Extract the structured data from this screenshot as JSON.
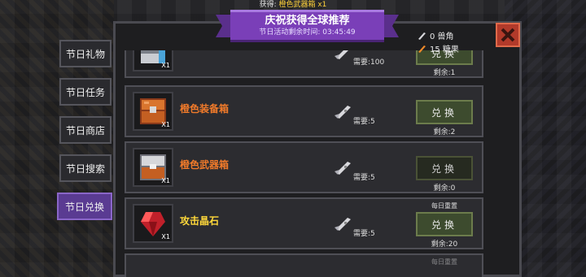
{
  "toast": {
    "prefix": "获得: ",
    "item": "橙色武器箱 x1"
  },
  "banner": {
    "title": "庆祝获得全球推荐",
    "timer": "节日活动剩余时间: 03:45:49"
  },
  "resources": [
    {
      "icon": "horn-icon",
      "text": "0 兽角"
    },
    {
      "icon": "candy-icon",
      "text": "15 糖果"
    }
  ],
  "tabs": [
    {
      "label": "节日礼物"
    },
    {
      "label": "节日任务"
    },
    {
      "label": "节日商店"
    },
    {
      "label": "节日搜索"
    },
    {
      "label": "节日兑换",
      "active": true
    }
  ],
  "items": [
    {
      "name": "",
      "icon": "supply-chest-icon",
      "qty": "X1",
      "cost": "需要:100",
      "button": "兑换",
      "remain": "剩余:1"
    },
    {
      "name": "橙色装备箱",
      "name_color": "#f07a2a",
      "icon": "orange-equipment-chest-icon",
      "qty": "X1",
      "cost": "需要:5",
      "button": "兑换",
      "remain": "剩余:2"
    },
    {
      "name": "橙色武器箱",
      "name_color": "#f07a2a",
      "icon": "orange-weapon-chest-icon",
      "qty": "X1",
      "cost": "需要:5",
      "button": "兑换",
      "remain": "剩余:0"
    },
    {
      "name": "攻击晶石",
      "name_color": "#ffd83a",
      "icon": "attack-crystal-icon",
      "qty": "X1",
      "cost": "需要:5",
      "button": "兑换",
      "remain": "剩余:20",
      "daily": "每日重置"
    }
  ],
  "footer_daily": "每日重置"
}
